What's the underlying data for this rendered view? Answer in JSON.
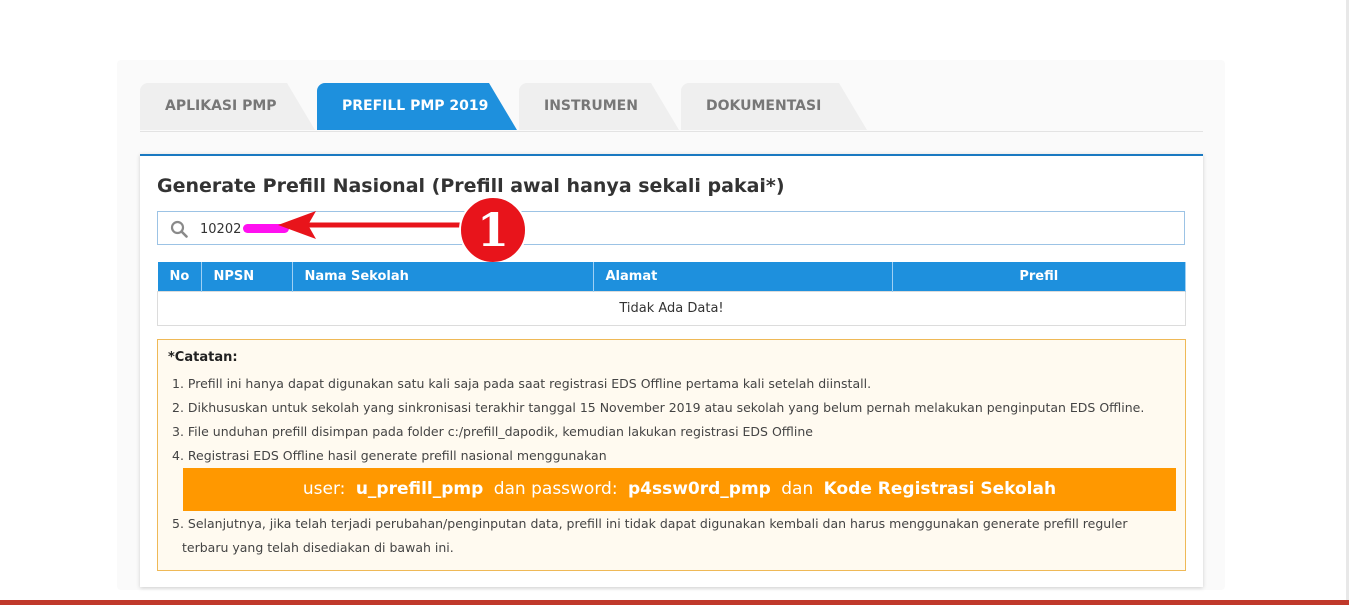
{
  "tabs": [
    {
      "label": "APLIKASI PMP",
      "active": false
    },
    {
      "label": "PREFILL PMP 2019",
      "active": true
    },
    {
      "label": "INSTRUMEN",
      "active": false
    },
    {
      "label": "DOKUMENTASI",
      "active": false
    }
  ],
  "panel": {
    "title": "Generate Prefill Nasional (Prefill awal hanya sekali pakai*)"
  },
  "search": {
    "value": "10202",
    "icon": "search-icon"
  },
  "annotation": {
    "marker": "1"
  },
  "table": {
    "headers": [
      "No",
      "NPSN",
      "Nama Sekolah",
      "Alamat",
      "Prefil"
    ],
    "empty_message": "Tidak Ada Data!"
  },
  "note": {
    "title": "*Catatan:",
    "items": [
      "1. Prefill ini hanya dapat digunakan satu kali saja pada saat registrasi EDS Offline pertama kali setelah diinstall.",
      "2. Dikhususkan untuk sekolah yang sinkronisasi terakhir tanggal 15 November 2019 atau sekolah yang belum pernah melakukan penginputan EDS Offline.",
      "3. File unduhan prefill disimpan pada folder c:/prefill_dapodik, kemudian lakukan registrasi EDS Offline",
      "4. Registrasi EDS Offline hasil generate prefill nasional menggunakan",
      "5. Selanjutnya, jika telah terjadi perubahan/penginputan data, prefill ini tidak dapat digunakan kembali dan harus menggunakan generate prefill reguler",
      "terbaru yang telah disediakan di bawah ini."
    ],
    "banner": {
      "user_label": "user:",
      "user_value": "u_prefill_pmp",
      "password_label": "dan password:",
      "password_value": "p4ssw0rd_pmp",
      "and_label": "dan",
      "code_label": "Kode Registrasi Sekolah"
    }
  },
  "colors": {
    "tab_active": "#1e90dd",
    "tab_inactive": "#efefef",
    "table_header": "#1e90dd",
    "banner": "#ff9800",
    "note_border": "#efb957",
    "annotation_red": "#e8141b"
  }
}
